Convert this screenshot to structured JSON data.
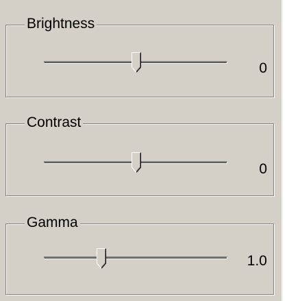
{
  "groups": [
    {
      "label": "Brightness",
      "value_text": "0",
      "position": 0.5
    },
    {
      "label": "Contrast",
      "value_text": "0",
      "position": 0.5
    },
    {
      "label": "Gamma",
      "value_text": "1.0",
      "position": 0.3
    }
  ],
  "colors": {
    "face": "#d4d0c8",
    "shadow": "#808080",
    "highlight": "#ffffff",
    "dark": "#404040"
  }
}
